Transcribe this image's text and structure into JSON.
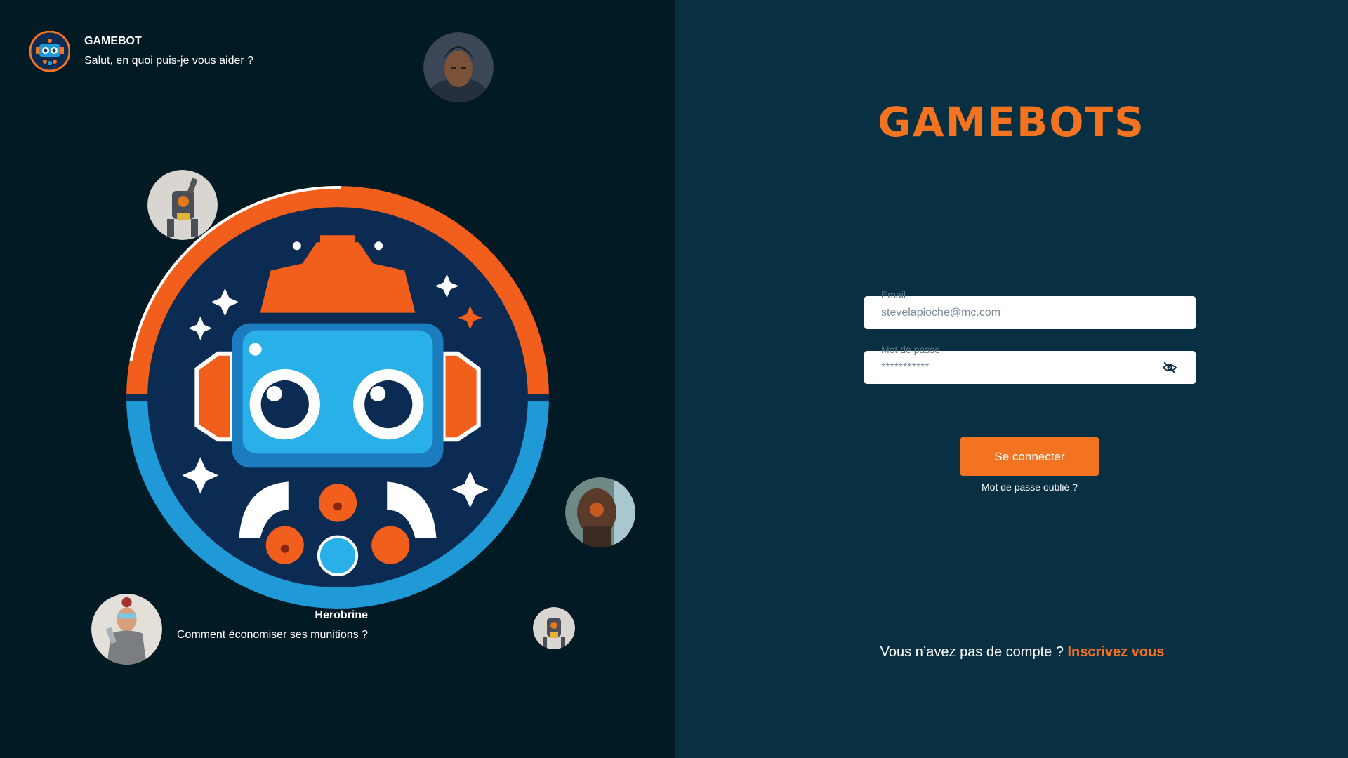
{
  "chat_top": {
    "name": "GAMEBOT",
    "message": "Salut, en quoi puis-je vous aider ?"
  },
  "chat_bottom": {
    "name": "Herobrine",
    "message": "Comment économiser ses munitions ?"
  },
  "brand": {
    "title": "GAMEBOTS"
  },
  "form": {
    "email_label": "Email",
    "email_value": "stevelapioche@mc.com",
    "password_label": "Mot de passe",
    "password_value": "***********",
    "submit_label": "Se connecter",
    "forgot_label": "Mot de passe oublié ?"
  },
  "signup": {
    "prompt": "Vous n’avez pas de compte ?",
    "link": "Inscrivez vous"
  },
  "colors": {
    "left_bg": "#011a24",
    "right_bg": "#082f42",
    "accent": "#f37321",
    "logo_blue": "#1f9ad6",
    "logo_navy": "#0b2b52"
  },
  "icons": {
    "password_toggle": "eye-off-icon"
  }
}
